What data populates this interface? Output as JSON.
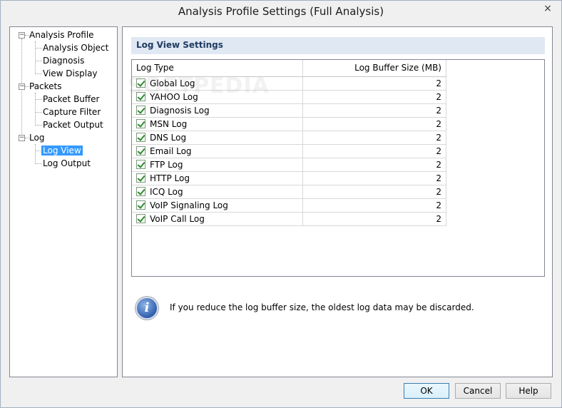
{
  "window": {
    "title": "Analysis Profile Settings (Full Analysis)"
  },
  "tree": {
    "groups": [
      {
        "label": "Analysis Profile",
        "children": [
          "Analysis Object",
          "Diagnosis",
          "View Display"
        ]
      },
      {
        "label": "Packets",
        "children": [
          "Packet Buffer",
          "Capture Filter",
          "Packet Output"
        ]
      },
      {
        "label": "Log",
        "children": [
          "Log View",
          "Log Output"
        ]
      }
    ],
    "selected": "Log View"
  },
  "section": {
    "title": "Log View Settings"
  },
  "grid": {
    "columns": [
      "Log Type",
      "Log Buffer Size (MB)"
    ],
    "rows": [
      {
        "name": "Global Log",
        "size": "2",
        "checked": true
      },
      {
        "name": "YAHOO Log",
        "size": "2",
        "checked": true
      },
      {
        "name": "Diagnosis Log",
        "size": "2",
        "checked": true
      },
      {
        "name": "MSN Log",
        "size": "2",
        "checked": true
      },
      {
        "name": "DNS Log",
        "size": "2",
        "checked": true
      },
      {
        "name": "Email Log",
        "size": "2",
        "checked": true
      },
      {
        "name": "FTP Log",
        "size": "2",
        "checked": true
      },
      {
        "name": "HTTP Log",
        "size": "2",
        "checked": true
      },
      {
        "name": "ICQ Log",
        "size": "2",
        "checked": true
      },
      {
        "name": "VoIP Signaling Log",
        "size": "2",
        "checked": true
      },
      {
        "name": "VoIP Call Log",
        "size": "2",
        "checked": true
      }
    ]
  },
  "info": {
    "text": "If you reduce the log buffer size, the oldest log data may be discarded.",
    "icon": "info-icon"
  },
  "watermark": "SOFTPEDIA",
  "buttons": {
    "ok": "OK",
    "cancel": "Cancel",
    "help": "Help"
  },
  "icons": {
    "close": "×",
    "collapse": "−"
  }
}
